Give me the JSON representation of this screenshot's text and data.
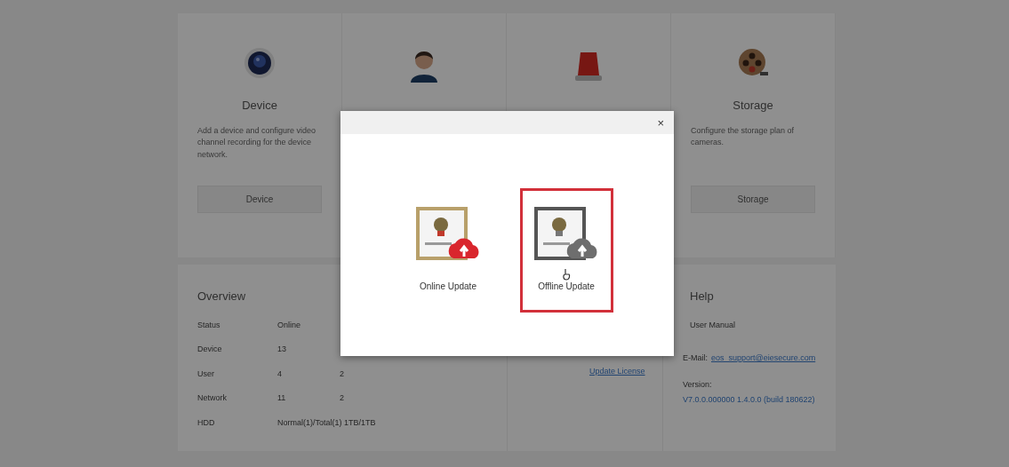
{
  "feature_cards": [
    {
      "kind": "device",
      "title": "Device",
      "description": "Add a device and configure video channel recording for the device network.",
      "button": "Device"
    },
    {
      "kind": "user"
    },
    {
      "kind": "alarm"
    },
    {
      "kind": "storage",
      "title": "Storage",
      "description": "Configure the storage plan of cameras.",
      "button": "Storage"
    }
  ],
  "overview": {
    "title": "Overview",
    "columns": [
      "Status",
      "Online"
    ],
    "rows": [
      {
        "label": "Device",
        "values": [
          "13"
        ]
      },
      {
        "label": "User",
        "values": [
          "4",
          "2"
        ]
      },
      {
        "label": "Network",
        "values": [
          "11",
          "2"
        ]
      },
      {
        "label": "HDD",
        "values": [
          "Normal(1)/Total(1) 1TB/1TB"
        ]
      }
    ]
  },
  "license_link": "Update License",
  "help": {
    "title": "Help",
    "manual": "User Manual",
    "email_label": "E-Mail:",
    "email": "eos_support@eiesecure.com",
    "version_label": "Version:",
    "version": "V7.0.0.000000 1.4.0.0 (build 180622)"
  },
  "dialog": {
    "close": "×",
    "options": [
      {
        "kind": "online",
        "label": "Online Update",
        "selected": false
      },
      {
        "kind": "offline",
        "label": "Offline Update",
        "selected": true
      }
    ]
  }
}
